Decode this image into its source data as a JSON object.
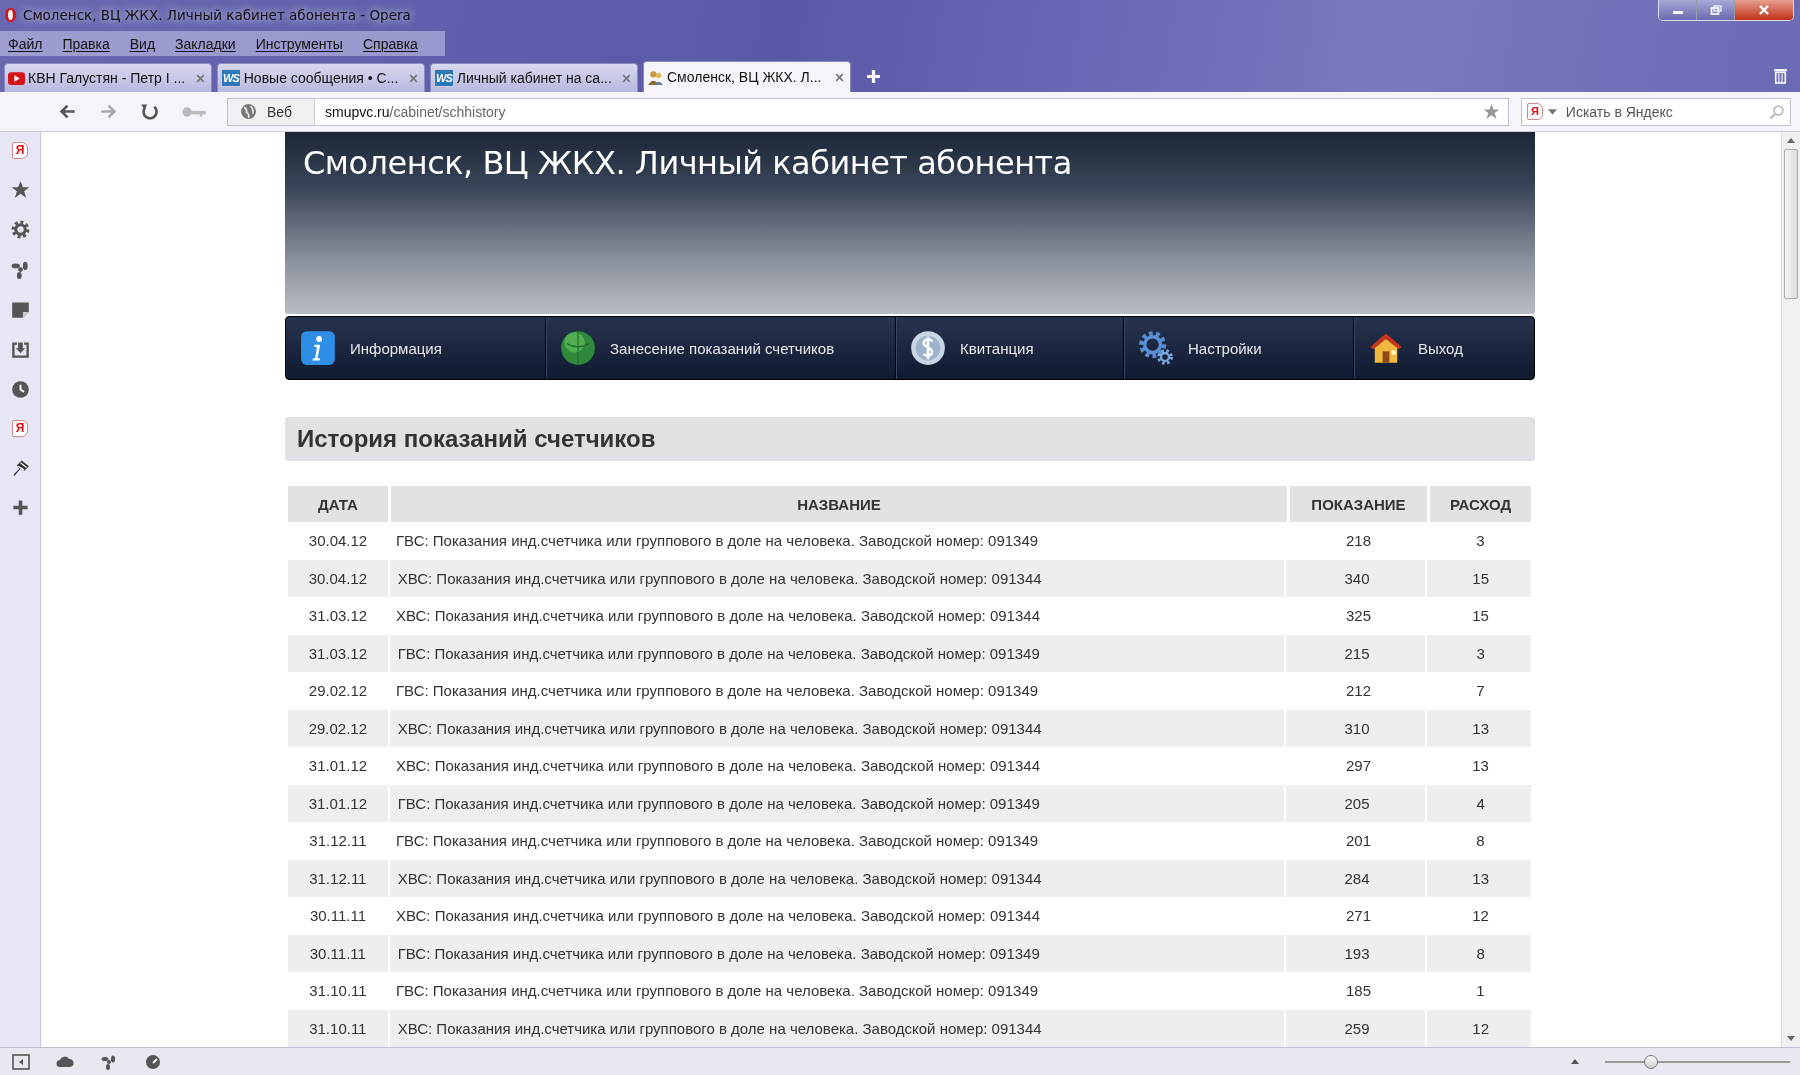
{
  "window": {
    "title": "Смоленск, ВЦ ЖКХ. Личный кабинет абонента - Opera"
  },
  "menu": [
    "Файл",
    "Правка",
    "Вид",
    "Закладки",
    "Инструменты",
    "Справка"
  ],
  "tabs": [
    {
      "label": "КВН Галустян - Петр I ...",
      "kind": "video",
      "selected": false
    },
    {
      "label": "Новые сообщения • С...",
      "kind": "ws",
      "icon_text": "WS",
      "selected": false
    },
    {
      "label": "Личный кабинет на са...",
      "kind": "ws",
      "icon_text": "WS",
      "selected": false
    },
    {
      "label": "Смоленск, ВЦ ЖКХ. Л...",
      "kind": "people",
      "selected": true
    }
  ],
  "address": {
    "scope": "Веб",
    "host": "smupvc.ru",
    "path": "/cabinet/schhistory"
  },
  "search": {
    "engine": "Я",
    "placeholder": "Искать в Яндекс"
  },
  "sidebar": [
    {
      "kind": "yandex",
      "label": "Я"
    },
    {
      "kind": "star"
    },
    {
      "kind": "gear"
    },
    {
      "kind": "unite"
    },
    {
      "kind": "note"
    },
    {
      "kind": "download"
    },
    {
      "kind": "clock"
    },
    {
      "kind": "yandex",
      "label": "Я"
    },
    {
      "kind": "extension"
    },
    {
      "kind": "plus"
    }
  ],
  "site": {
    "title": "Смоленск, ВЦ ЖКХ. Личный кабинет абонента"
  },
  "nav": [
    {
      "label": "Информация",
      "kind": "info"
    },
    {
      "label": "Занесение показаний счетчиков",
      "kind": "globe"
    },
    {
      "label": "Квитанция",
      "kind": "dollar"
    },
    {
      "label": "Настройки",
      "kind": "gears"
    },
    {
      "label": "Выход",
      "kind": "house"
    }
  ],
  "section": {
    "title": "История показаний счетчиков"
  },
  "table": {
    "columns": [
      "ДАТА",
      "НАЗВАНИЕ",
      "ПОКАЗАНИЕ",
      "РАСХОД"
    ],
    "rows": [
      [
        "30.04.12",
        "ГВС: Показания инд.счетчика или группового в доле на человека. Заводской номер: 091349",
        "218",
        "3"
      ],
      [
        "30.04.12",
        "ХВС: Показания инд.счетчика или группового в доле на человека. Заводской номер: 091344",
        "340",
        "15"
      ],
      [
        "31.03.12",
        "ХВС: Показания инд.счетчика или группового в доле на человека. Заводской номер: 091344",
        "325",
        "15"
      ],
      [
        "31.03.12",
        "ГВС: Показания инд.счетчика или группового в доле на человека. Заводской номер: 091349",
        "215",
        "3"
      ],
      [
        "29.02.12",
        "ГВС: Показания инд.счетчика или группового в доле на человека. Заводской номер: 091349",
        "212",
        "7"
      ],
      [
        "29.02.12",
        "ХВС: Показания инд.счетчика или группового в доле на человека. Заводской номер: 091344",
        "310",
        "13"
      ],
      [
        "31.01.12",
        "ХВС: Показания инд.счетчика или группового в доле на человека. Заводской номер: 091344",
        "297",
        "13"
      ],
      [
        "31.01.12",
        "ГВС: Показания инд.счетчика или группового в доле на человека. Заводской номер: 091349",
        "205",
        "4"
      ],
      [
        "31.12.11",
        "ГВС: Показания инд.счетчика или группового в доле на человека. Заводской номер: 091349",
        "201",
        "8"
      ],
      [
        "31.12.11",
        "ХВС: Показания инд.счетчика или группового в доле на человека. Заводской номер: 091344",
        "284",
        "13"
      ],
      [
        "30.11.11",
        "ХВС: Показания инд.счетчика или группового в доле на человека. Заводской номер: 091344",
        "271",
        "12"
      ],
      [
        "30.11.11",
        "ГВС: Показания инд.счетчика или группового в доле на человека. Заводской номер: 091349",
        "193",
        "8"
      ],
      [
        "31.10.11",
        "ГВС: Показания инд.счетчика или группового в доле на человека. Заводской номер: 091349",
        "185",
        "1"
      ],
      [
        "31.10.11",
        "ХВС: Показания инд.счетчика или группового в доле на человека. Заводской номер: 091344",
        "259",
        "12"
      ]
    ]
  },
  "zoom": {
    "level": 0.25
  }
}
